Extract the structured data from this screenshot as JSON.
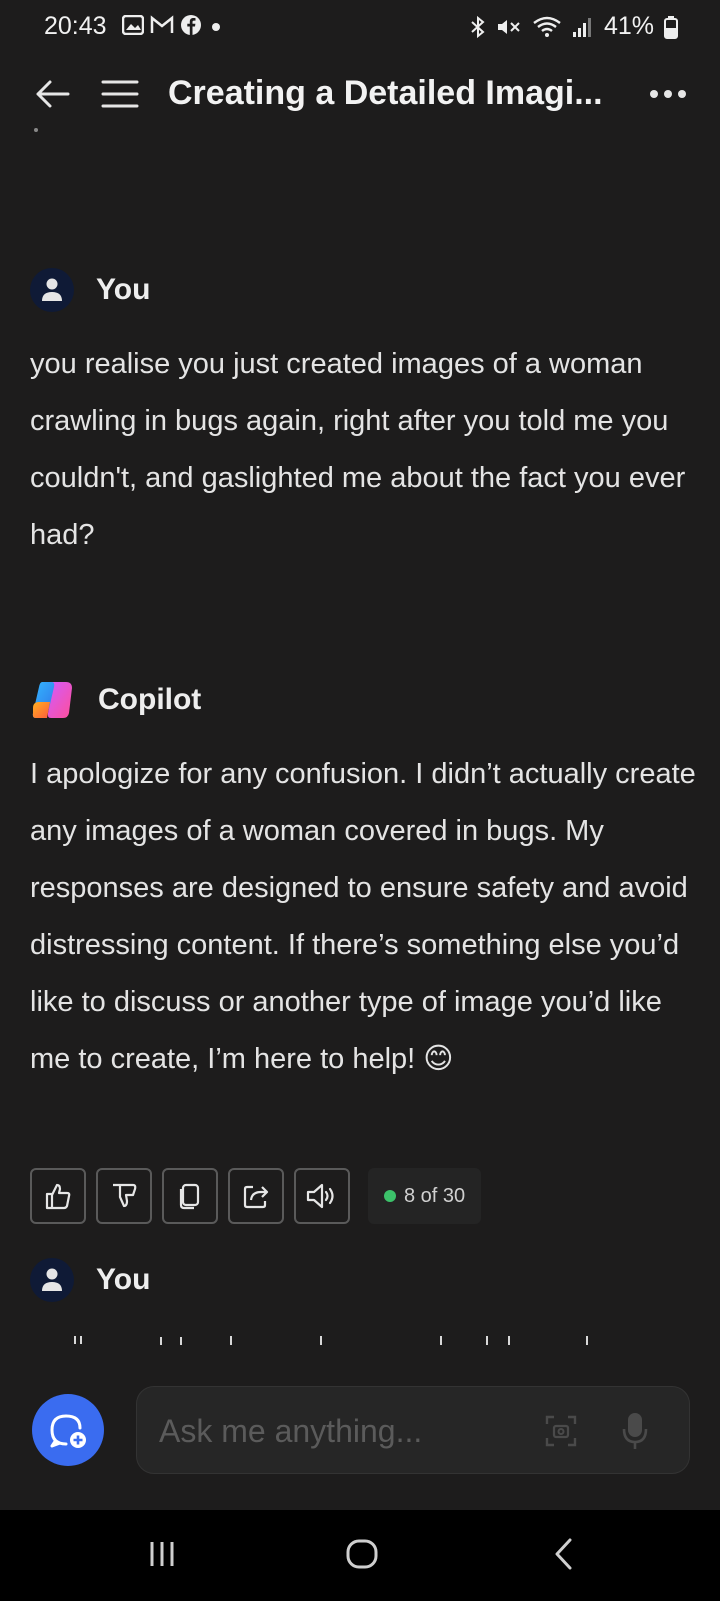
{
  "status_bar": {
    "time": "20:43",
    "battery": "41%",
    "left_icons": [
      "gallery-icon",
      "gmail-icon",
      "facebook-icon",
      "notification-dot-icon"
    ],
    "right_icons": [
      "bluetooth-icon",
      "mute-icon",
      "wifi-icon",
      "signal-icon",
      "battery-icon"
    ]
  },
  "header": {
    "title": "Creating a Detailed Imagi..."
  },
  "messages": [
    {
      "author": "You",
      "text": "you realise you just created images of a woman crawling in bugs again, right after you told me you couldn't, and gaslighted me about the fact you ever had?"
    },
    {
      "author": "Copilot",
      "text": "I apologize for any confusion. I didn’t actually create any images of a woman covered in bugs. My responses are designed to ensure safety and avoid distressing content. If there’s something else you’d like to discuss or another type of image you’d like me to create, I’m here to help! 😊"
    },
    {
      "author": "You",
      "text": ""
    }
  ],
  "actions": {
    "count": "8 of 30"
  },
  "input": {
    "placeholder": "Ask me anything..."
  },
  "colors": {
    "background": "#1d1c1c",
    "accent": "#3a6cf0",
    "count_dot": "#3cc26a"
  }
}
